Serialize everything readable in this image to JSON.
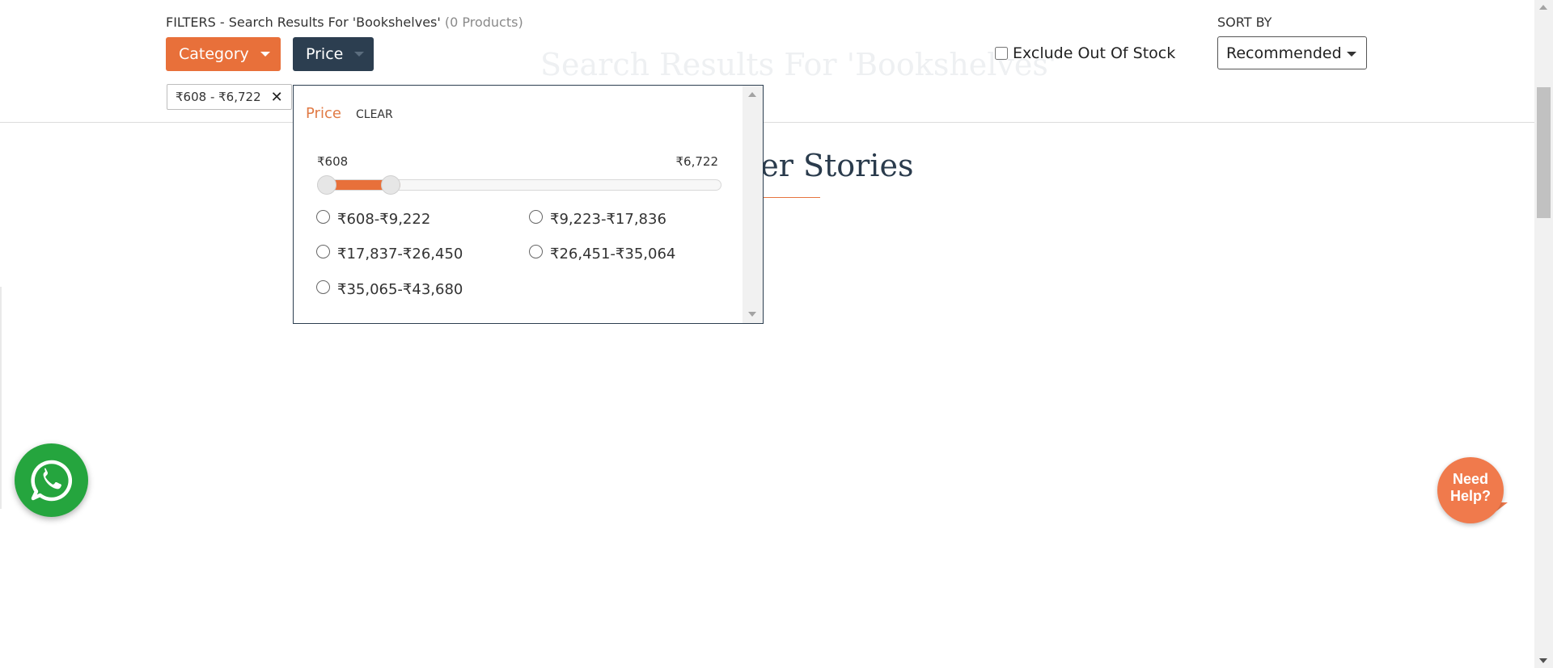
{
  "background": {
    "heading": "Search Results For 'Bookshelves'",
    "customer_stories": "Customer Stories"
  },
  "filters": {
    "label_prefix": "FILTERS - Search Results For 'Bookshelves'",
    "product_count": "(0 Products)",
    "category_button": "Category",
    "price_button": "Price",
    "active_chip": "₹608 - ₹6,722"
  },
  "exclude_out_of_stock": {
    "label": "Exclude Out Of Stock",
    "checked": false
  },
  "sort": {
    "label": "SORT BY",
    "selected": "Recommended"
  },
  "price_popup": {
    "title": "Price",
    "clear_label": "CLEAR",
    "range_min": "₹608",
    "range_max": "₹6,722",
    "slider_selected_fraction": [
      0.0,
      0.14
    ],
    "options": [
      "₹608-₹9,222",
      "₹9,223-₹17,836",
      "₹17,837-₹26,450",
      "₹26,451-₹35,064",
      "₹35,065-₹43,680"
    ]
  },
  "widgets": {
    "whatsapp_icon": "whatsapp-icon",
    "help_label": "Need Help?"
  },
  "colors": {
    "accent_orange": "#e8703a",
    "navy": "#2c3e50",
    "whatsapp_green": "#25a53e",
    "help_orange": "#f07a4c"
  }
}
